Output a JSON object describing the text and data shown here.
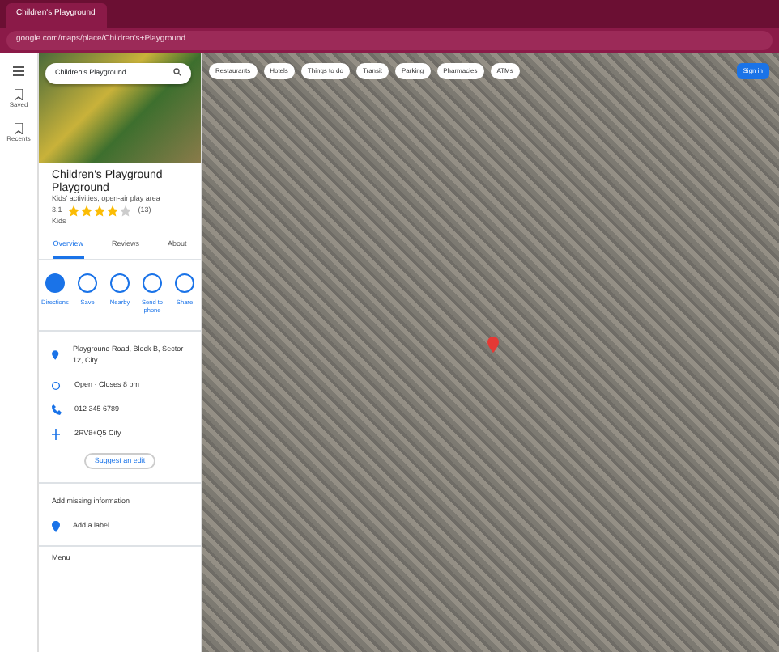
{
  "browser": {
    "tab_title": "Children's Playground",
    "address": "google.com/maps/place/Children's+Playground"
  },
  "rail": [
    {
      "label": "Saved"
    },
    {
      "label": "Recents"
    }
  ],
  "search": {
    "value": "Children's Playground"
  },
  "chips": [
    {
      "label": "Restaurants"
    },
    {
      "label": "Hotels"
    },
    {
      "label": "Things to do"
    },
    {
      "label": "Transit"
    },
    {
      "label": "Parking"
    },
    {
      "label": "Pharmacies"
    },
    {
      "label": "ATMs"
    }
  ],
  "sign_in": "Sign in",
  "place": {
    "title": "Children's Playground",
    "category": "Playground",
    "subtitle": "Kids' activities, open-air play area",
    "rating": "3.1",
    "stars": 4,
    "reviews": "(13)",
    "price": "Kids"
  },
  "tabs": [
    {
      "label": "Overview",
      "selected": true
    },
    {
      "label": "Reviews",
      "selected": false
    },
    {
      "label": "About",
      "selected": false
    }
  ],
  "actions": [
    {
      "label": "Directions",
      "primary": true
    },
    {
      "label": "Save",
      "primary": false
    },
    {
      "label": "Nearby",
      "primary": false
    },
    {
      "label": "Send to phone",
      "primary": false
    },
    {
      "label": "Share",
      "primary": false
    }
  ],
  "details": [
    {
      "kind": "place",
      "text": "Playground Road, Block B, Sector 12, City"
    },
    {
      "kind": "clock",
      "text": "Open · Closes 8 pm"
    },
    {
      "kind": "phone",
      "text": "012 345 6789"
    },
    {
      "kind": "plus",
      "text": "2RV8+Q5 City"
    }
  ],
  "suggest": "Suggest an edit",
  "missing": "Add missing information",
  "add_label": "Add a label",
  "footer": "Menu"
}
